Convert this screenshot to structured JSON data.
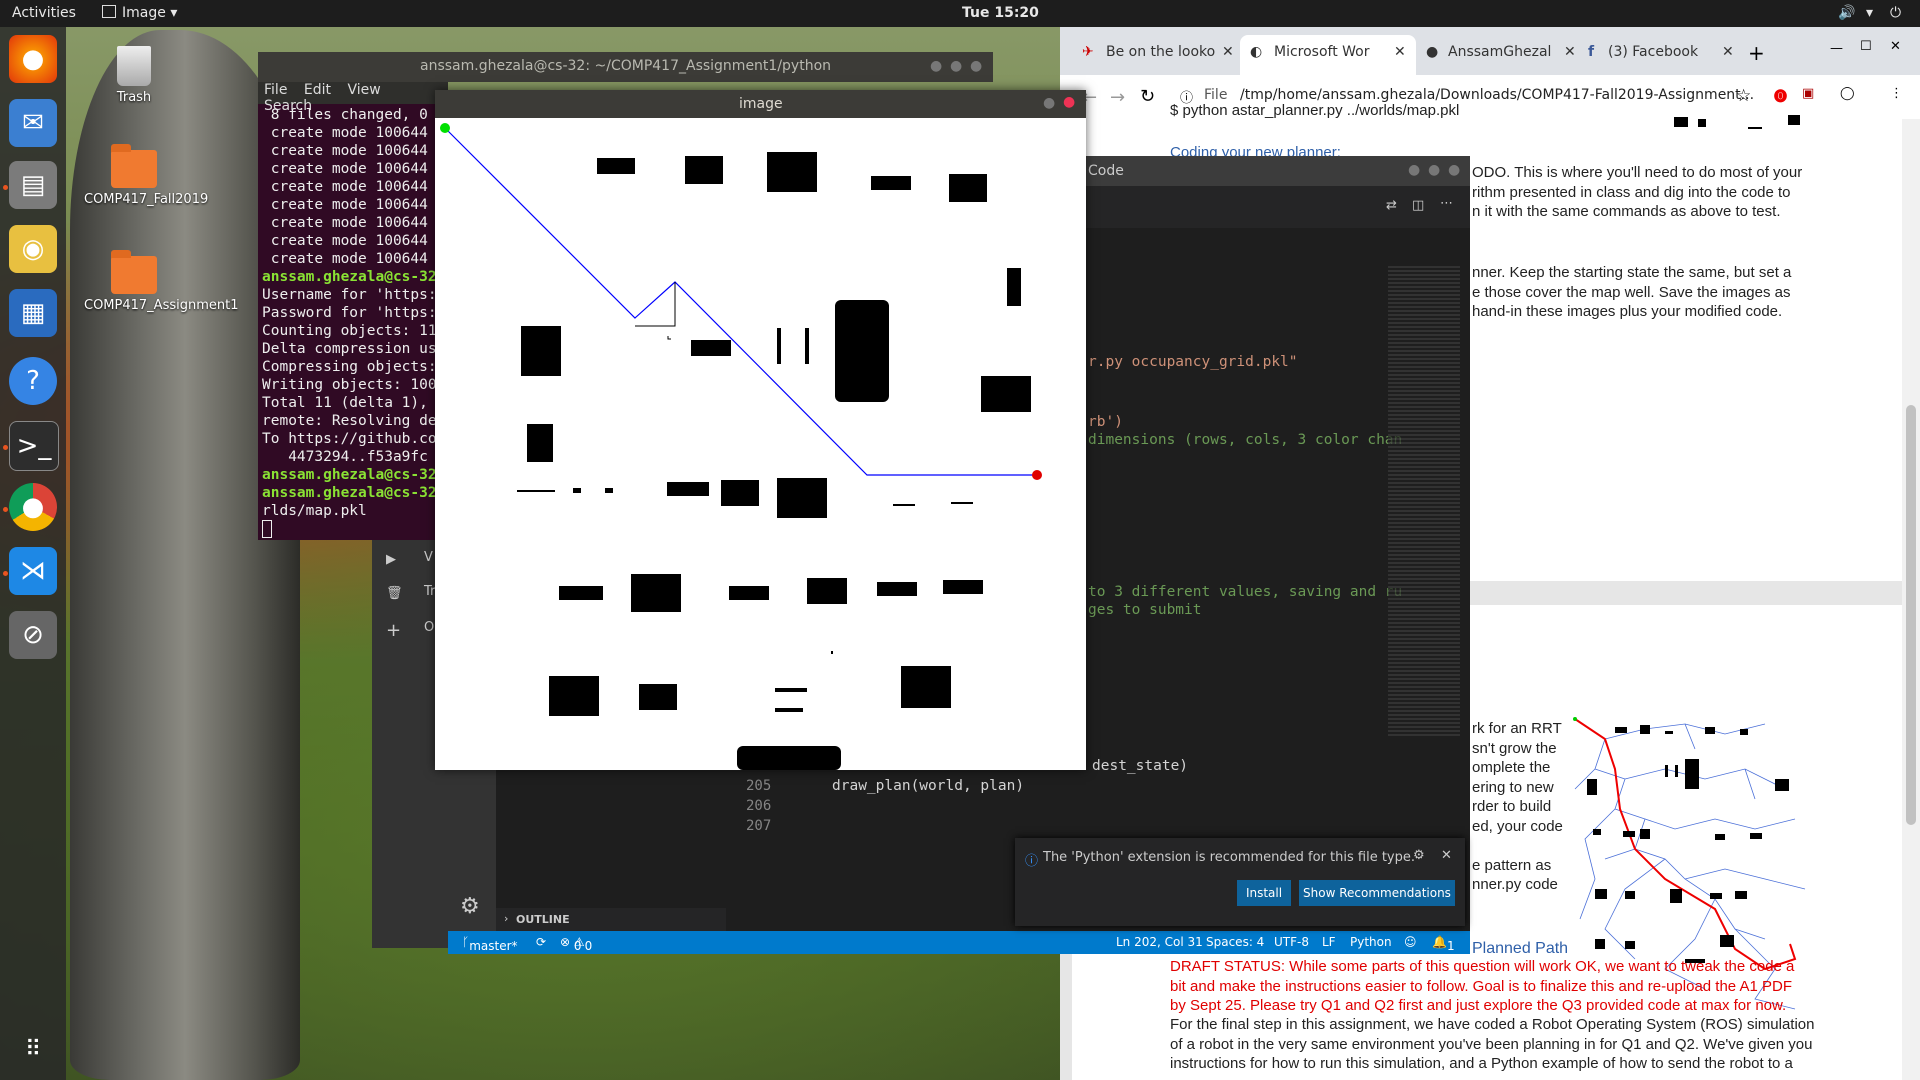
{
  "topbar": {
    "activities": "Activities",
    "app_menu": "Image",
    "clock": "Tue 15:20"
  },
  "desktop": {
    "icons": [
      {
        "label": "Trash"
      },
      {
        "label": "COMP417_Fall2019"
      },
      {
        "label": "COMP417_Assignment1"
      }
    ]
  },
  "terminal": {
    "title": "anssam.ghezala@cs-32: ~/COMP417_Assignment1/python",
    "menu": [
      "File",
      "Edit",
      "View",
      "Search"
    ],
    "lines": [
      " 8 files changed, 0",
      " create mode 100644",
      " create mode 100644",
      " create mode 100644",
      " create mode 100644",
      " create mode 100644",
      " create mode 100644",
      " create mode 100644",
      " create mode 100644",
      "anssam.ghezala@cs-32",
      "Username for 'https:",
      "Password for 'https:",
      "Counting objects: 11",
      "Delta compression us",
      "Compressing objects:",
      "Writing objects: 100",
      "Total 11 (delta 1),",
      "remote: Resolving de",
      "To https://github.co",
      "   4473294..f53a9fc",
      "anssam.ghezala@cs-32",
      "anssam.ghezala@cs-32",
      "rlds/map.pkl"
    ]
  },
  "vscode": {
    "title": "Code",
    "code_lines": [
      {
        "text": "r.py occupancy_grid.pkl\"",
        "color": "#ce9178"
      },
      {
        "text": "rb')",
        "color": "#ce9178"
      },
      {
        "text": "dimensions (rows, cols, 3 color chan",
        "color": "#6a9955"
      },
      {
        "text": "to 3 different values, saving and ru",
        "color": "#6a9955"
      },
      {
        "text": "ges to submit",
        "color": "#6a9955"
      }
    ],
    "gutter": [
      "205",
      "206",
      "207"
    ],
    "line_204_tail": "dest_state)",
    "line_205": "draw_plan(world, plan)",
    "notification": {
      "message": "The 'Python' extension is recommended for this file type.",
      "install": "Install",
      "show_recommendations": "Show Recommendations"
    },
    "outline": "OUTLINE",
    "side_labels": [
      "V",
      "Tr",
      "O"
    ],
    "status": {
      "branch": "master*",
      "errors": "0",
      "warnings": "0",
      "position": "Ln 202, Col 31",
      "spaces": "Spaces: 4",
      "encoding": "UTF-8",
      "eol": "LF",
      "language": "Python",
      "bell": "1"
    }
  },
  "image_window": {
    "title": "image",
    "start_color": "#00e000",
    "goal_color": "#e00000",
    "path_color": "#0000ff"
  },
  "chrome": {
    "tabs": [
      {
        "title": "Be on the looko"
      },
      {
        "title": "Microsoft Wor"
      },
      {
        "title": "AnssamGhezal"
      },
      {
        "title": "(3) Facebook"
      }
    ],
    "url_scheme": "File",
    "url": "/tmp/home/anssam.ghezala/Downloads/COMP417-Fall2019-Assignment..."
  },
  "document": {
    "page1_top": "$ python astar_planner.py ../worlds/map.pkl",
    "coding_heading": "Coding your new planner:",
    "p1": [
      "ODO. This is where you'll need to do most of your",
      "rithm presented in class and dig into the code to",
      "n it with the same commands as above to test."
    ],
    "p2": [
      "nner. Keep the starting state the same, but set a",
      "e  those  cover  the  map  well.  Save  the  images  as",
      "hand-in these images plus your modified code."
    ],
    "p3": [
      "rk for an RRT",
      "sn't grow the",
      "omplete  the",
      "ering  to  new",
      "rder to build",
      "ed, your code",
      "",
      "e  pattern  as",
      "nner.py  code"
    ],
    "planned_path_heading": "Planned Path",
    "draft": [
      "DRAFT STATUS: While some parts of this question will work OK, we want to tweak the code a",
      "bit and make the instructions easier to follow. Goal is to finalize this and re-upload the A1 PDF",
      "by Sept 25. Please try Q1 and Q2 first and just explore the Q3 provided code at max for now."
    ],
    "final": [
      "For the final step in this assignment, we have coded a Robot Operating System (ROS) simulation",
      "of a robot in the very same environment you've been planning in for Q1 and Q2. We've given you",
      "instructions for how to run this simulation, and a Python example of how to send the robot to a"
    ]
  }
}
